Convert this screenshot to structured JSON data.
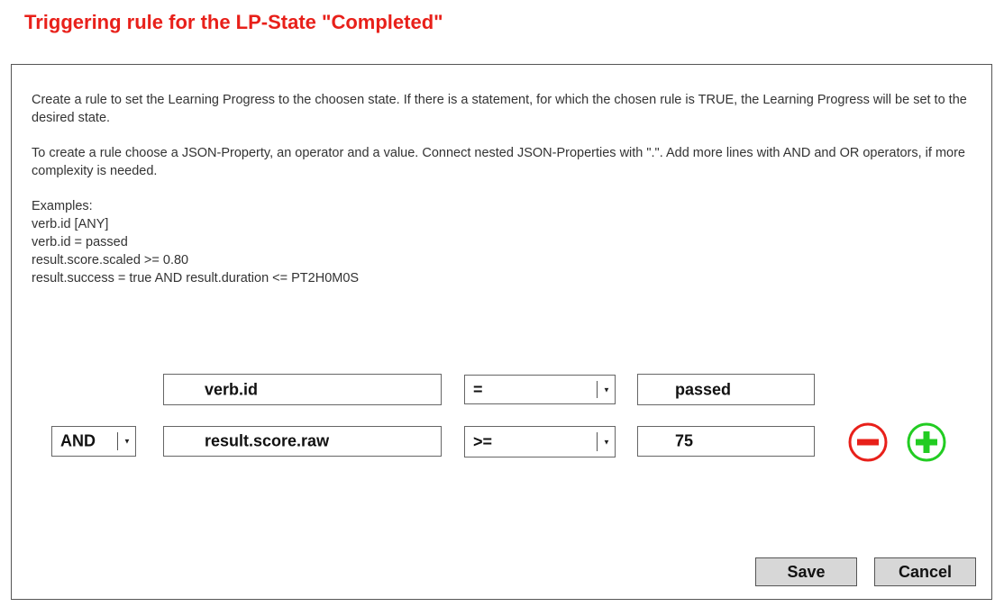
{
  "title": "Triggering rule for the LP-State \"Completed\"",
  "description": {
    "para1": "Create a rule to set the Learning Progress to the choosen state. If there is a statement, for which the chosen rule is TRUE, the Learning Progress will be set to the desired state.",
    "para2": "To create a rule choose a JSON-Property, an operator and a value. Connect nested JSON-Properties with \".\". Add more lines with AND and OR operators, if more complexity is needed.",
    "examples_heading": "Examples:",
    "examples": [
      "verb.id [ANY]",
      "verb.id = passed",
      "result.score.scaled >= 0.80",
      "result.success = true AND result.duration <= PT2H0M0S"
    ]
  },
  "rules": [
    {
      "property": "verb.id",
      "operator": "=",
      "value": "passed"
    },
    {
      "connector": "AND",
      "property": "result.score.raw",
      "operator": ">=",
      "value": "75"
    }
  ],
  "icons": {
    "remove": "minus-circle-icon",
    "add": "plus-circle-icon",
    "dropdown": "chevron-down-icon"
  },
  "colors": {
    "title": "#e8201a",
    "remove": "#e8201a",
    "add": "#22cc22",
    "button_bg": "#d7d7d7"
  },
  "buttons": {
    "save": "Save",
    "cancel": "Cancel"
  }
}
